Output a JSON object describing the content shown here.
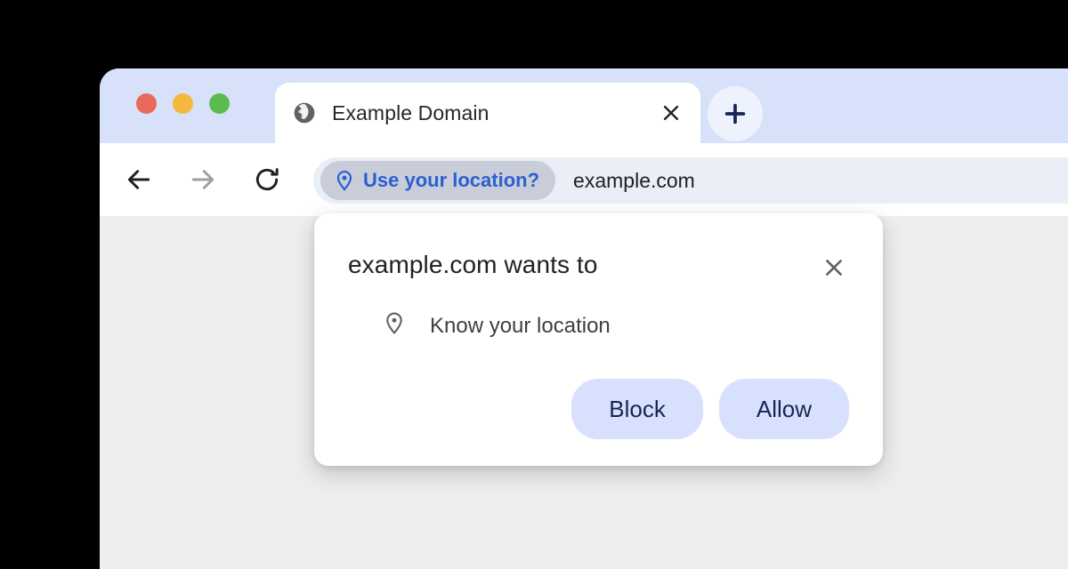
{
  "window": {
    "traffic_lights": [
      {
        "name": "close",
        "color": "#e8695c"
      },
      {
        "name": "minimize",
        "color": "#f2b93e"
      },
      {
        "name": "zoom",
        "color": "#5cbb4f"
      }
    ]
  },
  "tabs": {
    "active": {
      "title": "Example Domain",
      "favicon": "globe-icon",
      "close_icon": "close-icon"
    },
    "new_tab_label": "+"
  },
  "toolbar": {
    "back_icon": "arrow-left-icon",
    "forward_icon": "arrow-right-icon",
    "reload_icon": "reload-icon",
    "omnibox": {
      "chip_icon": "location-pin-icon",
      "chip_label": "Use your location?",
      "url": "example.com"
    }
  },
  "dialog": {
    "title": "example.com wants to",
    "close_icon": "close-icon",
    "permission_icon": "location-pin-icon",
    "permission_label": "Know your location",
    "block_label": "Block",
    "allow_label": "Allow"
  },
  "colors": {
    "tab_strip": "#d7e1f9",
    "accent_blue": "#2b5fd0",
    "button_fill": "#d7e1fd",
    "button_text": "#172554",
    "chip_fill": "#c8cdd9",
    "omnibox_fill": "#eaeef7",
    "page_background": "#eeeeee",
    "backdrop": "#000000"
  }
}
